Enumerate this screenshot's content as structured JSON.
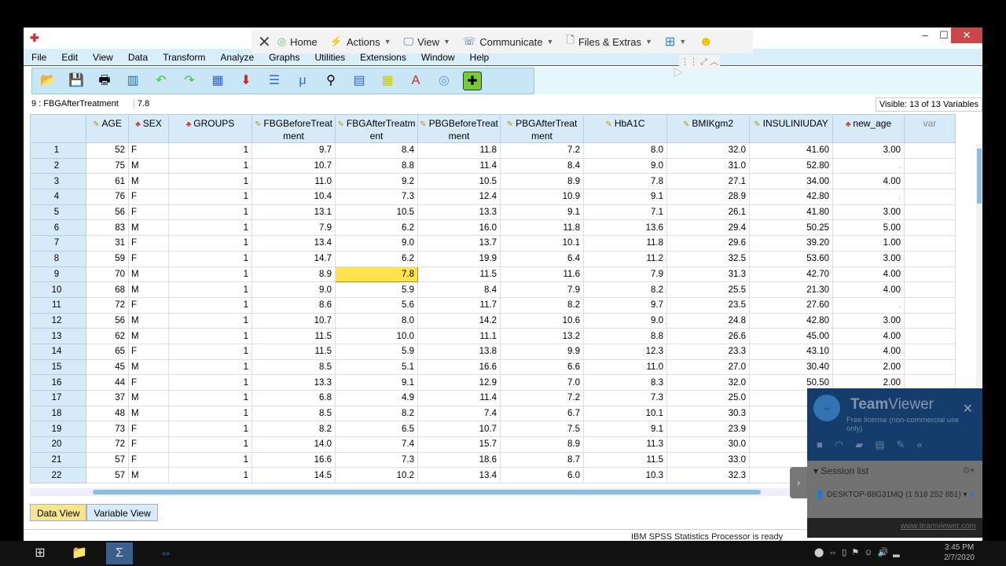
{
  "window": {
    "minimize": "‒",
    "maximize": "☐",
    "close": "✕"
  },
  "menu": [
    "File",
    "Edit",
    "View",
    "Data",
    "Transform",
    "Analyze",
    "Graphs",
    "Utilities",
    "Extensions",
    "Window",
    "Help"
  ],
  "cell_editor": {
    "ref": "9 : FBGAfterTreatment",
    "value": "7.8",
    "visible": "Visible: 13 of 13 Variables"
  },
  "columns": [
    {
      "name": "AGE",
      "icon": "ruler",
      "kind": "num"
    },
    {
      "name": "SEX",
      "icon": "nominal-a",
      "kind": "str"
    },
    {
      "name": "GROUPS",
      "icon": "nominal",
      "kind": "num"
    },
    {
      "name": "FBGBeforeTreat ment",
      "icon": "ruler",
      "kind": "num"
    },
    {
      "name": "FBGAfterTreatm ent",
      "icon": "ruler",
      "kind": "num"
    },
    {
      "name": "PBGBeforeTreat ment",
      "icon": "ruler",
      "kind": "num"
    },
    {
      "name": "PBGAfterTreat ment",
      "icon": "ruler",
      "kind": "num"
    },
    {
      "name": "HbA1C",
      "icon": "ruler",
      "kind": "num"
    },
    {
      "name": "BMIKgm2",
      "icon": "ruler",
      "kind": "num"
    },
    {
      "name": "INSULINIUDAY",
      "icon": "ruler",
      "kind": "num"
    },
    {
      "name": "new_age",
      "icon": "nominal",
      "kind": "num"
    },
    {
      "name": "var",
      "icon": "",
      "kind": "empty"
    }
  ],
  "rows": [
    [
      "52",
      "F",
      "1",
      "9.7",
      "8.4",
      "11.8",
      "7.2",
      "8.0",
      "32.0",
      "41.60",
      "3.00"
    ],
    [
      "75",
      "M",
      "1",
      "10.7",
      "8.8",
      "11.4",
      "8.4",
      "9.0",
      "31.0",
      "52.80",
      "."
    ],
    [
      "61",
      "M",
      "1",
      "11.0",
      "9.2",
      "10.5",
      "8.9",
      "7.8",
      "27.1",
      "34.00",
      "4.00"
    ],
    [
      "76",
      "F",
      "1",
      "10.4",
      "7.3",
      "12.4",
      "10.9",
      "9.1",
      "28.9",
      "42.80",
      "."
    ],
    [
      "56",
      "F",
      "1",
      "13.1",
      "10.5",
      "13.3",
      "9.1",
      "7.1",
      "26.1",
      "41.80",
      "3.00"
    ],
    [
      "83",
      "M",
      "1",
      "7.9",
      "6.2",
      "16.0",
      "11.8",
      "13.6",
      "29.4",
      "50.25",
      "5.00"
    ],
    [
      "31",
      "F",
      "1",
      "13.4",
      "9.0",
      "13.7",
      "10.1",
      "11.8",
      "29.6",
      "39.20",
      "1.00"
    ],
    [
      "59",
      "F",
      "1",
      "14.7",
      "6.2",
      "19.9",
      "6.4",
      "11.2",
      "32.5",
      "53.60",
      "3.00"
    ],
    [
      "70",
      "M",
      "1",
      "8.9",
      "7.8",
      "11.5",
      "11.6",
      "7.9",
      "31.3",
      "42.70",
      "4.00"
    ],
    [
      "68",
      "M",
      "1",
      "9.0",
      "5.9",
      "8.4",
      "7.9",
      "8.2",
      "25.5",
      "21.30",
      "4.00"
    ],
    [
      "72",
      "F",
      "1",
      "8.6",
      "5.6",
      "11.7",
      "8.2",
      "9.7",
      "23.5",
      "27.60",
      "."
    ],
    [
      "56",
      "M",
      "1",
      "10.7",
      "8.0",
      "14.2",
      "10.6",
      "9.0",
      "24.8",
      "42.80",
      "3.00"
    ],
    [
      "62",
      "M",
      "1",
      "11.5",
      "10.0",
      "11.1",
      "13.2",
      "8.8",
      "26.6",
      "45.00",
      "4.00"
    ],
    [
      "65",
      "F",
      "1",
      "11.5",
      "5.9",
      "13.8",
      "9.9",
      "12.3",
      "23.3",
      "43.10",
      "4.00"
    ],
    [
      "45",
      "M",
      "1",
      "8.5",
      "5.1",
      "16.6",
      "6.6",
      "11.0",
      "27.0",
      "30.40",
      "2.00"
    ],
    [
      "44",
      "F",
      "1",
      "13.3",
      "9.1",
      "12.9",
      "7.0",
      "8.3",
      "32.0",
      "50.50",
      "2.00"
    ],
    [
      "37",
      "M",
      "1",
      "6.8",
      "4.9",
      "11.4",
      "7.2",
      "7.3",
      "25.0",
      "",
      ""
    ],
    [
      "48",
      "M",
      "1",
      "8.5",
      "8.2",
      "7.4",
      "6.7",
      "10.1",
      "30.3",
      "",
      ""
    ],
    [
      "73",
      "F",
      "1",
      "8.2",
      "6.5",
      "10.7",
      "7.5",
      "9.1",
      "23.9",
      "",
      ""
    ],
    [
      "72",
      "F",
      "1",
      "14.0",
      "7.4",
      "15.7",
      "8.9",
      "11.3",
      "30.0",
      "",
      ""
    ],
    [
      "57",
      "F",
      "1",
      "16.6",
      "7.3",
      "18.6",
      "8.7",
      "11.5",
      "33.0",
      "",
      ""
    ],
    [
      "57",
      "M",
      "1",
      "14.5",
      "10.2",
      "13.4",
      "6.0",
      "10.3",
      "32.3",
      "",
      ""
    ]
  ],
  "selected": {
    "row": 9,
    "col": "FBGAfterTreatment"
  },
  "tabs": {
    "data_view": "Data View",
    "variable_view": "Variable View"
  },
  "status": "IBM SPSS Statistics Processor is ready",
  "teamviewer_bar": {
    "home": "Home",
    "actions": "Actions",
    "view": "View",
    "communicate": "Communicate",
    "files": "Files & Extras"
  },
  "teamviewer_panel": {
    "title_bold": "Team",
    "title_rest": "Viewer",
    "license": "Free license (non-commercial use only)",
    "session_list": "Session list",
    "device": "DESKTOP-88G31MQ (1 518 252 851)",
    "url": "www.teamviewer.com"
  },
  "taskbar": {
    "time": "3:45 PM",
    "date": "2/7/2020"
  }
}
